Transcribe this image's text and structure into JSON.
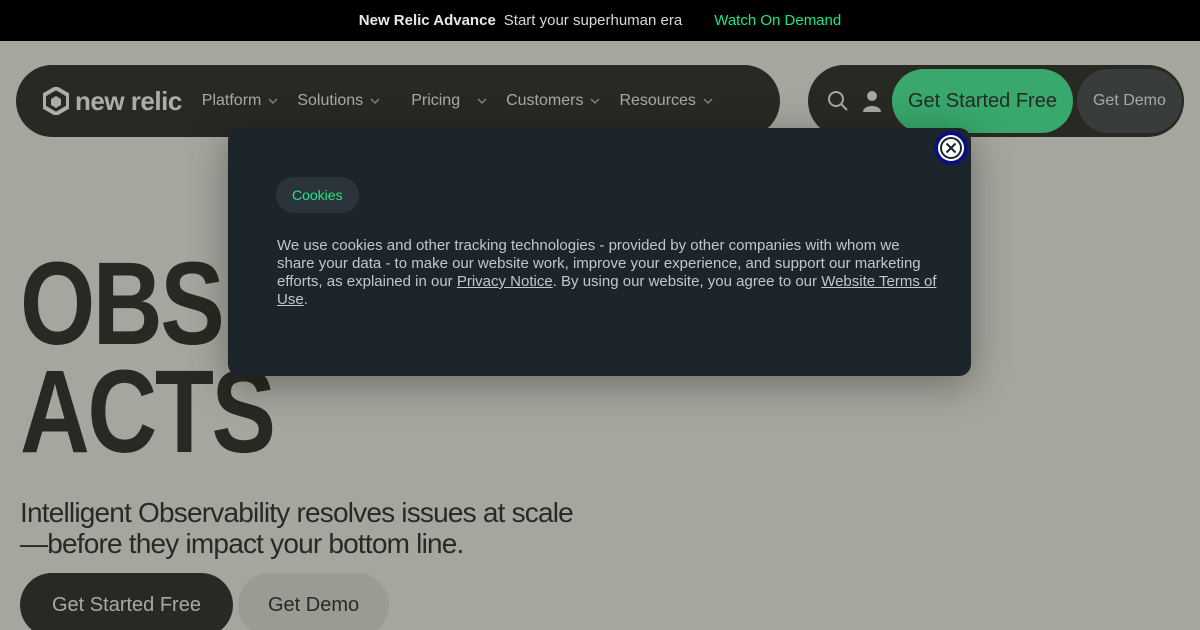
{
  "banner": {
    "brand": "New Relic Advance",
    "tagline": "Start your superhuman era",
    "link": "Watch On Demand"
  },
  "nav": {
    "logo_text": "new relic",
    "items": [
      {
        "label": "Platform"
      },
      {
        "label": "Solutions"
      },
      {
        "label": "Pricing"
      },
      {
        "label": "Customers"
      },
      {
        "label": "Resources"
      }
    ],
    "cta_primary": "Get Started Free",
    "cta_secondary": "Get Demo"
  },
  "hero": {
    "title_line1": "OBSE",
    "title_line2": "ACTS",
    "subtitle": "Intelligent Observability resolves issues at scale—before they impact your bottom line.",
    "cta_primary": "Get Started Free",
    "cta_secondary": "Get Demo"
  },
  "cookie_dialog": {
    "badge": "Cookies",
    "text_part1": "We use cookies and other tracking technologies - provided by other companies with whom we share your data - to make our website work, improve your experience, and support our marketing efforts, as explained in our ",
    "privacy_link": "Privacy Notice",
    "text_part2": ". By using our website, you agree to our ",
    "terms_link": "Website Terms of Use",
    "text_part3": "."
  },
  "colors": {
    "accent_green": "#1ce783",
    "dialog_bg": "#1d252c",
    "page_bg": "#e3e4de"
  },
  "icons": {
    "search": "search-icon",
    "user": "user-icon",
    "close": "close-icon",
    "chevron": "chevron-down-icon",
    "logo": "new-relic-logo-icon"
  }
}
